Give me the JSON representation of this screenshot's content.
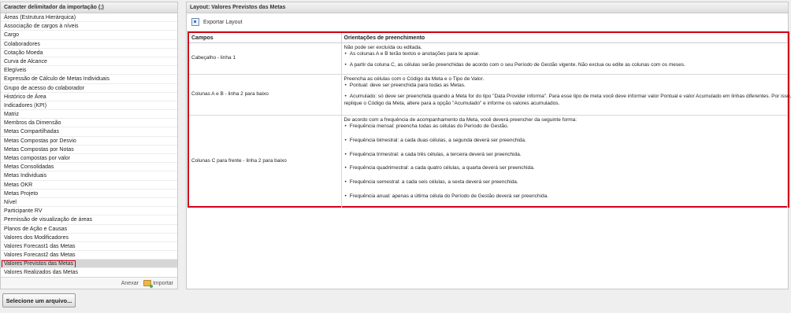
{
  "left_panel": {
    "title": "Caracter delimitador da importação (;)",
    "items": [
      "Áreas (Estrutura Hierárquica)",
      "Associação de cargos à níveis",
      "Cargo",
      "Colaboradores",
      "Cotação Moeda",
      "Curva de Alcance",
      "Elegíveis",
      "Expressão de Cálculo de Metas Individuais",
      "Grupo de acesso do colaborador",
      "Histórico de Área",
      "Indicadores (KPI)",
      "Matriz",
      "Membros da Dimensão",
      "Metas Compartilhadas",
      "Metas Compostas por Desvio",
      "Metas Compostas por Notas",
      "Metas compostas por valor",
      "Metas Consolidadas",
      "Metas Individuais",
      "Metas OKR",
      "Metas Projeto",
      "Nível",
      "Participante RV",
      "Permissão de visualização de áreas",
      "Planos de Ação e Causas",
      "Valores dos Modificadores",
      "Valores Forecast1 das Metas",
      "Valores Forecast2 das Metas",
      "Valores Previstos das Metas",
      "Valores Realizados das Metas"
    ],
    "selected_index": 28,
    "footer": {
      "anexar": "Anexar",
      "importar": "Importar"
    }
  },
  "select_file_button": "Selecione um arquivo...",
  "right_panel": {
    "title": "Layout: Valores Previstos das Metas",
    "export_label": "Exportar Layout",
    "table": {
      "headers": [
        "Campos",
        "Orientações de preenchimento"
      ],
      "rows": [
        {
          "field": "Cabeçalho - linha 1",
          "lines": [
            {
              "text": "Não pode ser excluída ou editada."
            },
            {
              "text": "As colunas A e B terão textos e anotações para te apoiar.",
              "bullet": true
            },
            {
              "text": "A partir da coluna C, as células serão preenchidas de acordo com o seu Período de Gestão vigente. Não exclua ou edite as colunas com os meses.",
              "bullet": true,
              "gap": true
            }
          ]
        },
        {
          "field": "Colunas A e B - linha 2 para baixo",
          "lines": [
            {
              "text": "Preencha as células com o Código da Meta e o Tipo de Valor."
            },
            {
              "text": "Pontual: deve ser preenchida para todas as Metas.",
              "bullet": true
            },
            {
              "text": "Acumulado: só deve ser preenchida quando a Meta for do tipo \"Data Provider informa\". Para esse tipo de meta você deve informar valor Pontual e valor Acumulado em linhas diferentes. Por isso,",
              "bullet": true,
              "gap": true
            },
            {
              "text": "replique o Código da Meta, altere para a opção \"Acumulado\" e informe os valores acumulados."
            }
          ]
        },
        {
          "field": "Colunas C para frente - linha 2 para baixo",
          "lines": [
            {
              "text": "De acordo com a frequência de acompanhamento da Meta, você deverá preencher da seguinte forma:"
            },
            {
              "text": "Frequência mensal: preencha todas as células do Período de Gestão.",
              "bullet": true
            },
            {
              "text": "Frequência bimestral: a cada duas células, a segunda deverá ser preenchida.",
              "bullet": true,
              "gap_lg": true
            },
            {
              "text": "Frequência trimestral: a cada três células, a terceira deverá ser preenchida.",
              "bullet": true,
              "gap_lg": true
            },
            {
              "text": "Frequência quadrimestral: a cada quatro células, a quarta deverá ser preenchida.",
              "bullet": true,
              "gap_lg": true
            },
            {
              "text": "Frequência semestral: a cada seis células, a sexta deverá ser preenchida.",
              "bullet": true,
              "gap_lg": true
            },
            {
              "text": "Frequência anual: apenas a última célula do Período de Gestão deverá ser preenchida.",
              "bullet": true,
              "gap_lg": true
            }
          ]
        }
      ]
    }
  },
  "colors": {
    "highlight_border": "#d0021b",
    "selected_row": "#d6d6d6"
  }
}
